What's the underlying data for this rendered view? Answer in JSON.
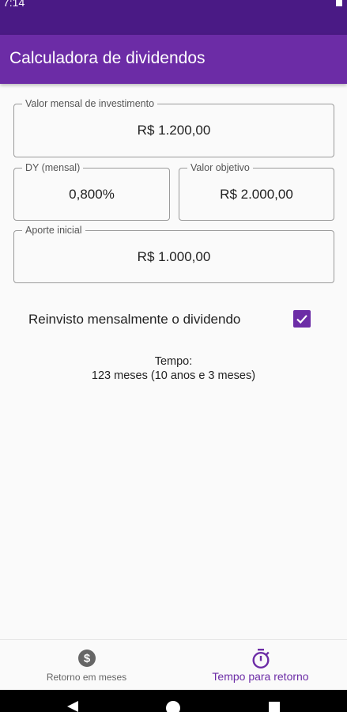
{
  "status_bar": {
    "time": "7:14"
  },
  "app_bar": {
    "title": "Calculadora de dividendos"
  },
  "form": {
    "monthly_investment": {
      "label": "Valor mensal de investimento",
      "value": "R$ 1.200,00"
    },
    "dy": {
      "label": "DY (mensal)",
      "value": "0,800%"
    },
    "target_value": {
      "label": "Valor objetivo",
      "value": "R$ 2.000,00"
    },
    "initial_contribution": {
      "label": "Aporte inicial",
      "value": "R$ 1.000,00"
    },
    "reinvest": {
      "label": "Reinvisto mensalmente o dividendo",
      "checked": true
    }
  },
  "result": {
    "heading": "Tempo:",
    "text": "123 meses (10 anos e 3 meses)"
  },
  "bottom_nav": {
    "items": [
      {
        "label": "Retorno em meses",
        "icon": "dollar-icon",
        "active": false
      },
      {
        "label": "Tempo para retorno",
        "icon": "timer-icon",
        "active": true
      }
    ]
  },
  "colors": {
    "status_bar": "#4a1a85",
    "app_bar": "#6c2ca6",
    "accent": "#6c2ca6"
  }
}
